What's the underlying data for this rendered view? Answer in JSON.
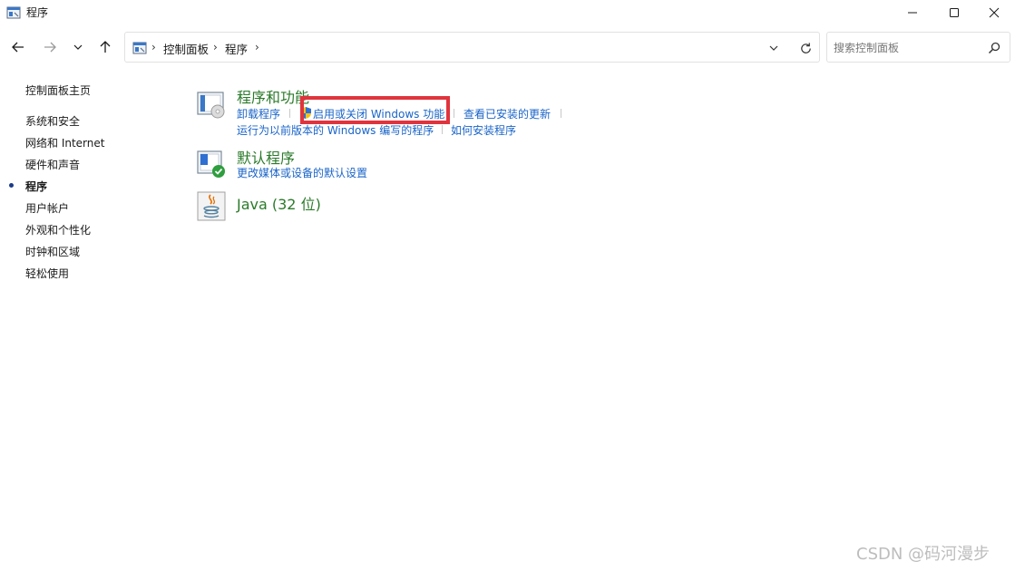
{
  "window": {
    "title": "程序"
  },
  "address": {
    "crumbs": [
      "控制面板",
      "程序"
    ],
    "search_placeholder": "搜索控制面板"
  },
  "sidebar": {
    "home": "控制面板主页",
    "items": [
      "系统和安全",
      "网络和 Internet",
      "硬件和声音",
      "程序",
      "用户帐户",
      "外观和个性化",
      "时钟和区域",
      "轻松使用"
    ],
    "active_index": 3
  },
  "categories": {
    "programs": {
      "title": "程序和功能",
      "links": [
        "卸载程序",
        "启用或关闭 Windows 功能",
        "查看已安装的更新",
        "运行为以前版本的 Windows 编写的程序",
        "如何安装程序"
      ]
    },
    "defaults": {
      "title": "默认程序",
      "links": [
        "更改媒体或设备的默认设置"
      ]
    },
    "java": {
      "title": "Java (32 位)"
    }
  },
  "watermark": "CSDN @码河漫步",
  "colors": {
    "category_title": "#2a7a2a",
    "link": "#1a64c8",
    "highlight": "#e0343d"
  },
  "icons": {
    "app": "control-panel-icon",
    "programs": "programs-features-icon",
    "defaults": "default-programs-icon",
    "java": "java-icon",
    "shield": "uac-shield-icon"
  }
}
